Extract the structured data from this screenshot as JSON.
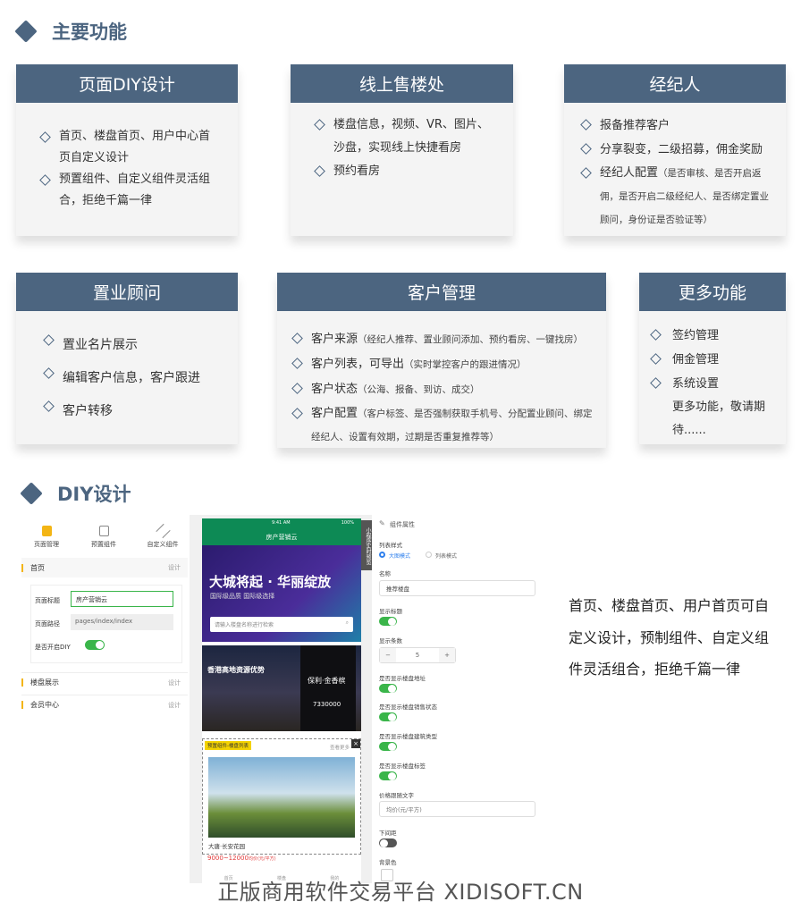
{
  "section1": {
    "title": "主要功能"
  },
  "cards": [
    {
      "title": "页面DIY设计",
      "items": [
        {
          "text": "首页、楼盘首页、用户中心首页自定义设计"
        },
        {
          "text": "预置组件、自定义组件灵活组合，拒绝千篇一律"
        }
      ]
    },
    {
      "title": "线上售楼处",
      "items": [
        {
          "text": "楼盘信息，视频、VR、图片、沙盘，实现线上快捷看房"
        },
        {
          "text": "预约看房"
        }
      ]
    },
    {
      "title": "经纪人",
      "items": [
        {
          "text": "报备推荐客户"
        },
        {
          "text": "分享裂变，二级招募，佣金奖励"
        },
        {
          "text": "经纪人配置",
          "note": "（是否审核、是否开启返佣，是否开启二级经纪人、是否绑定置业顾问，身份证是否验证等）"
        }
      ]
    },
    {
      "title": "置业顾问",
      "items": [
        {
          "text": "置业名片展示"
        },
        {
          "text": "编辑客户信息，客户跟进"
        },
        {
          "text": "客户转移"
        }
      ]
    },
    {
      "title": "客户管理",
      "items": [
        {
          "text": "客户来源",
          "note": "（经纪人推荐、置业顾问添加、预约看房、一键找房）"
        },
        {
          "text": "客户列表，可导出",
          "note": "（实时掌控客户的跟进情况）"
        },
        {
          "text": "客户状态",
          "note": "（公海、报备、到访、成交）"
        },
        {
          "text": "客户配置",
          "note": "（客户标签、是否强制获取手机号、分配置业顾问、绑定经纪人、设置有效期，过期是否重复推荐等）"
        }
      ]
    },
    {
      "title": "更多功能",
      "items": [
        {
          "text": "签约管理"
        },
        {
          "text": "佣金管理"
        },
        {
          "text": "系统设置"
        }
      ],
      "extra": "更多功能，敬请期待......"
    }
  ],
  "section2": {
    "title": "DIY设计"
  },
  "left_panel": {
    "tabs": [
      "页面管理",
      "预置组件",
      "自定义组件"
    ],
    "home": {
      "label": "首页",
      "action": "设计"
    },
    "form": {
      "title_label": "页面标题",
      "title_value": "房产营销云",
      "path_label": "页面路径",
      "path_value": "pages/index/index",
      "diy_label": "是否开启DIY",
      "diy_on": true
    },
    "rows": [
      {
        "label": "楼盘展示",
        "action": "设计"
      },
      {
        "label": "会员中心",
        "action": "设计"
      }
    ]
  },
  "phone": {
    "time": "9:41 AM",
    "battery": "100%",
    "title": "房产营销云",
    "side_tag": "小程序实时预览",
    "banner_title": "大城将起 · 华丽绽放",
    "banner_sub": "国际级品质 国际级选择",
    "search_placeholder": "请输入楼盘名称进行检索",
    "slide_text1": "香港高地资源优势",
    "slide_text2": "保利·金香槟",
    "slide_phone": "7330000",
    "preset_tag": "预置组件-楼盘列表",
    "see_more": "查看更多",
    "list_name": "大唐·长安花园",
    "list_price": "9000~12000",
    "list_price_unit": "均价(元/平方)",
    "nav": [
      "首页",
      "楼盘",
      "我的"
    ]
  },
  "props": {
    "header": "组件属性",
    "list_style_label": "列表样式",
    "opt1": "大图模式",
    "opt2": "列表模式",
    "name_label": "名称",
    "name_value": "推荐楼盘",
    "show_title_label": "显示标题",
    "count_label": "显示条数",
    "count_value": "5",
    "t1": "是否显示楼盘地址",
    "t2": "是否显示楼盘销售状态",
    "t3": "是否显示楼盘建筑类型",
    "t4": "是否显示楼盘标签",
    "price_label": "价格跟随文字",
    "price_placeholder": "均价(元/平方)",
    "divider_label": "下间距",
    "bg_label": "背景色"
  },
  "description": "首页、楼盘首页、用户首页可自定义设计，预制组件、自定义组件灵活组合，拒绝千篇一律",
  "watermark": "正版商用软件交易平台 XIDISOFT.CN"
}
